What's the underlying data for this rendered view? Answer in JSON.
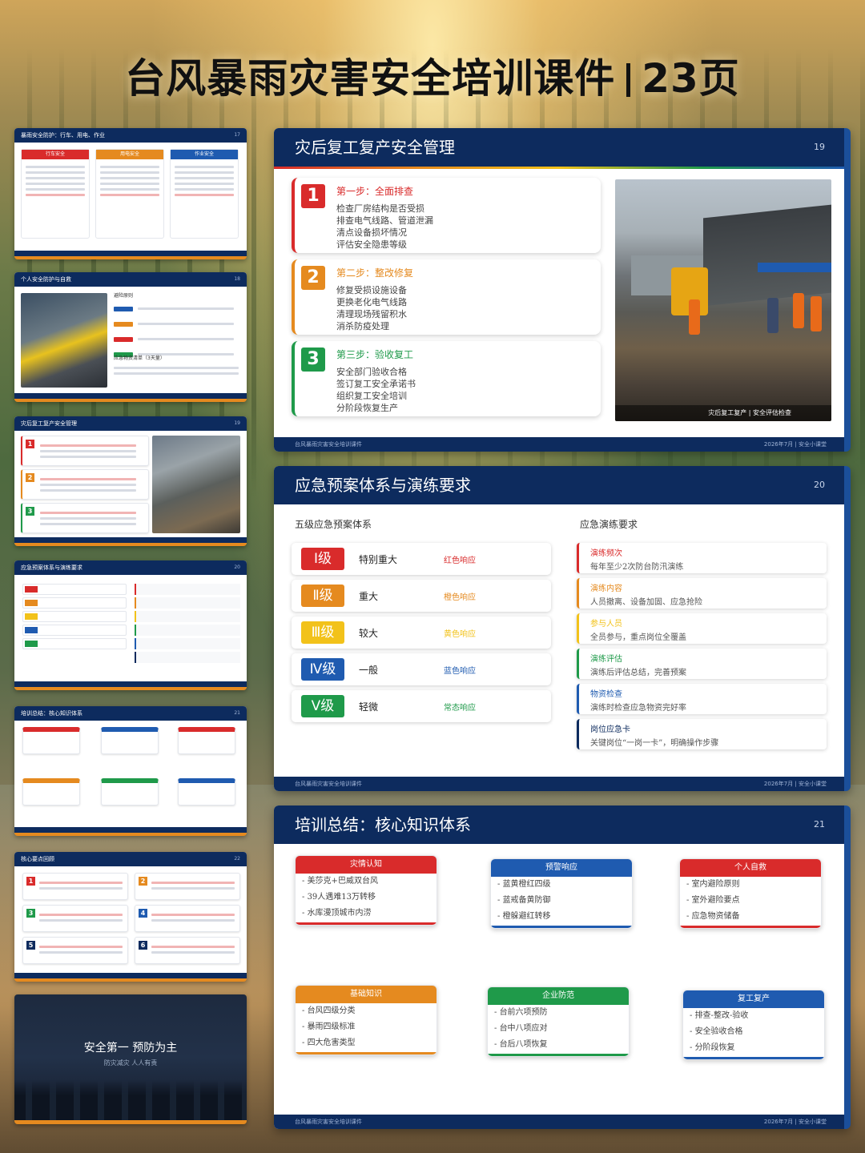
{
  "title": {
    "text": "台风暴雨灾害安全培训课件",
    "pages": "23页"
  },
  "thumbs": [
    {
      "title": "暴雨安全防护：行车、用电、作业",
      "page": "17",
      "cols": [
        {
          "label": "行车安全",
          "color": "#d92b2b"
        },
        {
          "label": "用电安全",
          "color": "#e58a1f"
        },
        {
          "label": "作业安全",
          "color": "#1f5bb0"
        }
      ]
    },
    {
      "title": "个人安全防护与自救",
      "page": "18",
      "sub1": "避险原则",
      "sub2": "应急物资清单（3天量）"
    },
    {
      "title": "灾后复工复产安全管理",
      "page": "19"
    },
    {
      "title": "应急预案体系与演练要求",
      "page": "20"
    },
    {
      "title": "培训总结：核心知识体系",
      "page": "21"
    },
    {
      "title": "核心要点回顾",
      "page": "22"
    }
  ],
  "closing": {
    "line1": "安全第一  预防为主",
    "line2": "防灾减灾  人人有责"
  },
  "slide19": {
    "title": "灾后复工复产安全管理",
    "page": "19",
    "steps": [
      {
        "num": "1",
        "title": "第一步：全面排查",
        "color": "#d92b2b",
        "lines": [
          "检查厂房结构是否受损",
          "排查电气线路、管道泄漏",
          "清点设备损坏情况",
          "评估安全隐患等级"
        ]
      },
      {
        "num": "2",
        "title": "第二步：整改修复",
        "color": "#e58a1f",
        "lines": [
          "修复受损设施设备",
          "更换老化电气线路",
          "清理现场残留积水",
          "消杀防疫处理"
        ]
      },
      {
        "num": "3",
        "title": "第三步：验收复工",
        "color": "#1f9a4a",
        "lines": [
          "安全部门验收合格",
          "签订复工安全承诺书",
          "组织复工安全培训",
          "分阶段恢复生产"
        ]
      }
    ],
    "photo_caption": "灾后复工复产 | 安全评估检查",
    "footer_left": "台风暴雨灾害安全培训课件",
    "footer_right": "2026年7月 | 安全小课堂"
  },
  "slide20": {
    "title": "应急预案体系与演练要求",
    "page": "20",
    "left_title": "五级应急预案体系",
    "right_title": "应急演练要求",
    "levels": [
      {
        "tag": "Ⅰ级",
        "name": "特别重大",
        "resp": "红色响应",
        "color": "#d92b2b"
      },
      {
        "tag": "Ⅱ级",
        "name": "重大",
        "resp": "橙色响应",
        "color": "#e58a1f"
      },
      {
        "tag": "Ⅲ级",
        "name": "较大",
        "resp": "黄色响应",
        "color": "#f2c21a"
      },
      {
        "tag": "Ⅳ级",
        "name": "一般",
        "resp": "蓝色响应",
        "color": "#1f5bb0"
      },
      {
        "tag": "Ⅴ级",
        "name": "轻微",
        "resp": "常态响应",
        "color": "#1f9a4a"
      }
    ],
    "reqs": [
      {
        "t": "演练频次",
        "d": "每年至少2次防台防汛演练",
        "color": "#d92b2b"
      },
      {
        "t": "演练内容",
        "d": "人员撤离、设备加固、应急抢险",
        "color": "#e58a1f"
      },
      {
        "t": "参与人员",
        "d": "全员参与，重点岗位全覆盖",
        "color": "#f2c21a"
      },
      {
        "t": "演练评估",
        "d": "演练后评估总结，完善预案",
        "color": "#1f9a4a"
      },
      {
        "t": "物资检查",
        "d": "演练时检查应急物资完好率",
        "color": "#1f5bb0"
      },
      {
        "t": "岗位应急卡",
        "d": "关键岗位“一岗一卡”，明确操作步骤",
        "color": "#0d2b5e"
      }
    ],
    "footer_left": "台风暴雨灾害安全培训课件",
    "footer_right": "2026年7月 | 安全小课堂"
  },
  "slide21": {
    "title": "培训总结：核心知识体系",
    "page": "21",
    "cards": [
      {
        "h": "灾情认知",
        "color": "#d92b2b",
        "items": [
          "美莎克+巴威双台风",
          "39人遇难13万转移",
          "水库漫顶城市内涝"
        ]
      },
      {
        "h": "预警响应",
        "color": "#1f5bb0",
        "items": [
          "蓝黄橙红四级",
          "蓝戒备黄防御",
          "橙躲避红转移"
        ]
      },
      {
        "h": "个人自救",
        "color": "#d92b2b",
        "items": [
          "室内避险原则",
          "室外避险要点",
          "应急物资储备"
        ]
      },
      {
        "h": "基础知识",
        "color": "#e58a1f",
        "items": [
          "台风四级分类",
          "暴雨四级标准",
          "四大危害类型"
        ]
      },
      {
        "h": "企业防范",
        "color": "#1f9a4a",
        "items": [
          "台前六项预防",
          "台中八项应对",
          "台后八项恢复"
        ]
      },
      {
        "h": "复工复产",
        "color": "#1f5bb0",
        "items": [
          "排查-整改-验收",
          "安全验收合格",
          "分阶段恢复"
        ]
      }
    ],
    "footer_left": "台风暴雨灾害安全培训课件",
    "footer_right": "2026年7月 | 安全小课堂"
  }
}
